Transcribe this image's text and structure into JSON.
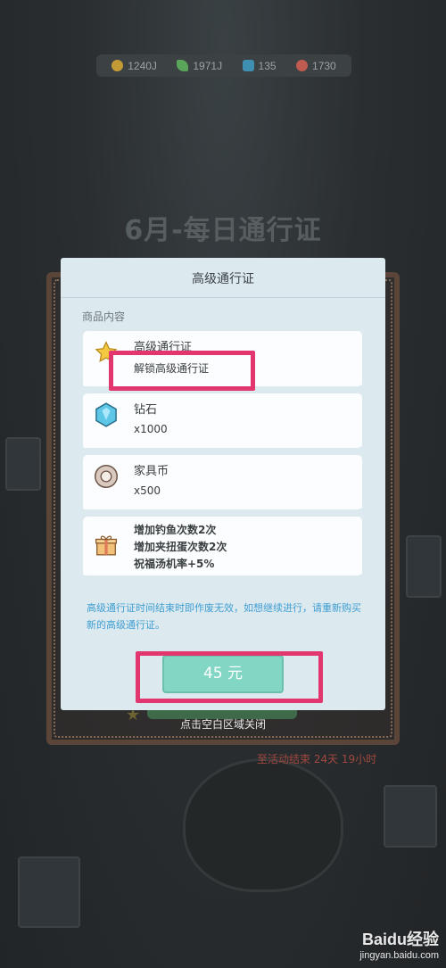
{
  "resources": [
    {
      "icon": "coin-icon",
      "value": "1240J",
      "color": "#c49a36"
    },
    {
      "icon": "leaf-icon",
      "value": "1971J",
      "color": "#5aa55a"
    },
    {
      "icon": "gem-icon",
      "value": "135",
      "color": "#3f8fb0"
    },
    {
      "icon": "shell-icon",
      "value": "1730",
      "color": "#c05b52"
    }
  ],
  "background": {
    "title": "6月-每日通行证",
    "time_left": "至活动结束 24天 19小时",
    "close_hint": "点击空白区域关闭"
  },
  "modal": {
    "title": "高级通行证",
    "section_label": "商品内容",
    "items": [
      {
        "icon": "star-icon",
        "name": "高级通行证",
        "desc": "解锁高级通行证"
      },
      {
        "icon": "diamond-icon",
        "name": "钻石",
        "desc": "x1000"
      },
      {
        "icon": "furniture-coin-icon",
        "name": "家具币",
        "desc": "x500"
      },
      {
        "icon": "gift-icon",
        "lines": [
          "增加钓鱼次数2次",
          "增加夹扭蛋次数2次",
          "祝福汤机率+5%"
        ]
      }
    ],
    "note": "高级通行证时间结束时即作废无效，如想继续进行，请重新购买新的高级通行证。",
    "buy_button": "45 元"
  },
  "watermark": {
    "logo": "Baidu经验",
    "sub": "jingyan.baidu.com"
  },
  "colors": {
    "highlight": "#e2376e",
    "buy_button": "#82d6c4",
    "note_text": "#3f9ed2",
    "modal_bg": "#dce9ef"
  }
}
